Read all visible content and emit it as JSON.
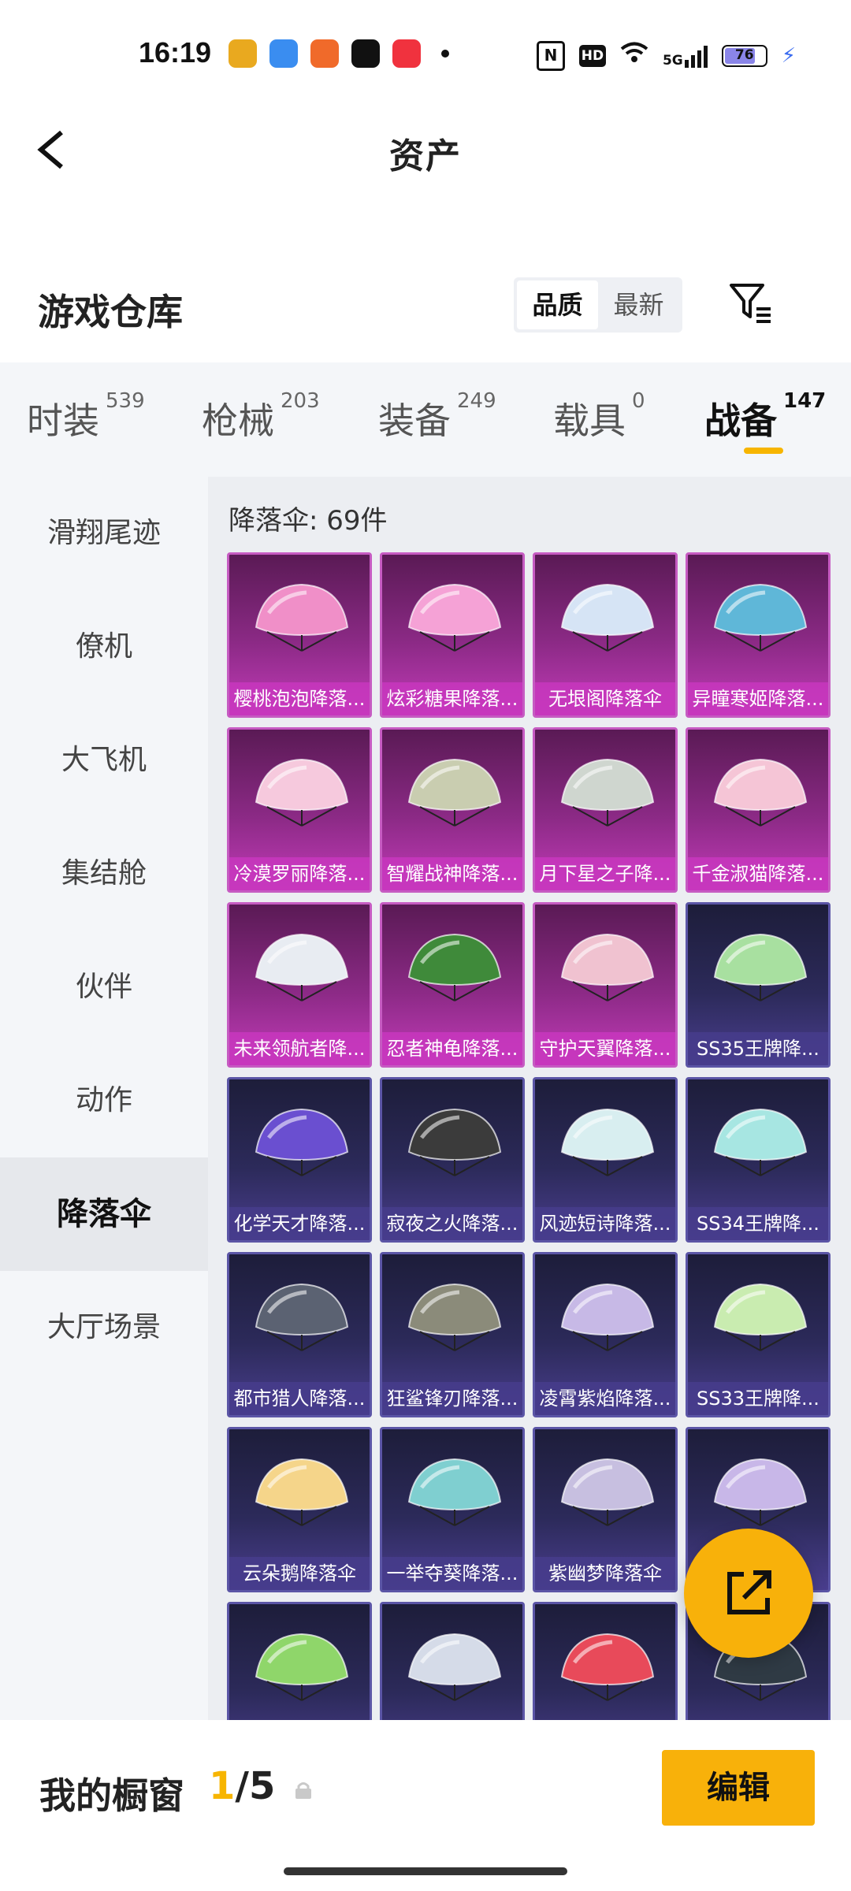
{
  "status_bar": {
    "time": "16:19",
    "network": "5G",
    "battery": "76"
  },
  "header": {
    "title": "资产"
  },
  "warehouse": {
    "title": "游戏仓库",
    "sort_quality": "品质",
    "sort_newest": "最新"
  },
  "tabs": [
    {
      "label": "时装",
      "count": "539"
    },
    {
      "label": "枪械",
      "count": "203"
    },
    {
      "label": "装备",
      "count": "249"
    },
    {
      "label": "载具",
      "count": "0"
    },
    {
      "label": "战备",
      "count": "147"
    }
  ],
  "sidebar": {
    "items": [
      "滑翔尾迹",
      "僚机",
      "大飞机",
      "集结舱",
      "伙伴",
      "动作",
      "降落伞",
      "大厅场景"
    ]
  },
  "content": {
    "count_label": "降落伞: 69件",
    "items": [
      {
        "name": "樱桃泡泡降落...",
        "rarity": "pink",
        "color": "#f08fc8"
      },
      {
        "name": "炫彩糖果降落...",
        "rarity": "pink",
        "color": "#f5a2d6"
      },
      {
        "name": "无垠阁降落伞",
        "rarity": "pink",
        "color": "#d6e4f5"
      },
      {
        "name": "异瞳寒姬降落...",
        "rarity": "pink",
        "color": "#5fb7d8"
      },
      {
        "name": "冷漠罗丽降落...",
        "rarity": "pink",
        "color": "#f6c9dd"
      },
      {
        "name": "智耀战神降落...",
        "rarity": "pink",
        "color": "#c9cdb0"
      },
      {
        "name": "月下星之子降...",
        "rarity": "pink",
        "color": "#cfd6cf"
      },
      {
        "name": "千金淑猫降落...",
        "rarity": "pink",
        "color": "#f5c5d6"
      },
      {
        "name": "未来领航者降...",
        "rarity": "pink",
        "color": "#e8ecf2"
      },
      {
        "name": "忍者神龟降落...",
        "rarity": "pink",
        "color": "#3f8a3a"
      },
      {
        "name": "守护天翼降落...",
        "rarity": "pink",
        "color": "#f0c2d0"
      },
      {
        "name": "SS35王牌降...",
        "rarity": "blue",
        "color": "#a8e0a0"
      },
      {
        "name": "化学天才降落...",
        "rarity": "blue",
        "color": "#6a4fd0"
      },
      {
        "name": "寂夜之火降落...",
        "rarity": "blue",
        "color": "#3b3b3b"
      },
      {
        "name": "风迹短诗降落...",
        "rarity": "blue",
        "color": "#d8eef0"
      },
      {
        "name": "SS34王牌降...",
        "rarity": "blue",
        "color": "#a7e6e2"
      },
      {
        "name": "都市猎人降落...",
        "rarity": "blue",
        "color": "#5b6272"
      },
      {
        "name": "狂鲨锋刃降落...",
        "rarity": "blue",
        "color": "#8b8b7a"
      },
      {
        "name": "凌霄紫焰降落...",
        "rarity": "blue",
        "color": "#c7b9e6"
      },
      {
        "name": "SS33王牌降...",
        "rarity": "blue",
        "color": "#c9ecb0"
      },
      {
        "name": "云朵鹅降落伞",
        "rarity": "blue",
        "color": "#f5d58a"
      },
      {
        "name": "一举夺葵降落...",
        "rarity": "blue",
        "color": "#7fcfd0"
      },
      {
        "name": "紫幽梦降落伞",
        "rarity": "blue",
        "color": "#c7bfe0"
      },
      {
        "name": "",
        "rarity": "blue",
        "color": "#c8b7e8"
      },
      {
        "name": "",
        "rarity": "blue",
        "color": "#8fd66a"
      },
      {
        "name": "",
        "rarity": "blue",
        "color": "#d5dbe8"
      },
      {
        "name": "",
        "rarity": "blue",
        "color": "#e84a5a"
      },
      {
        "name": "",
        "rarity": "blue",
        "color": "#2f3a44"
      }
    ]
  },
  "showcase": {
    "title": "我的橱窗",
    "current": "1",
    "total": "/5",
    "edit_label": "编辑"
  },
  "colors": {
    "accent": "#f8b10a",
    "pink_frame": "#c65bc2",
    "blue_frame": "#5b55a6"
  }
}
